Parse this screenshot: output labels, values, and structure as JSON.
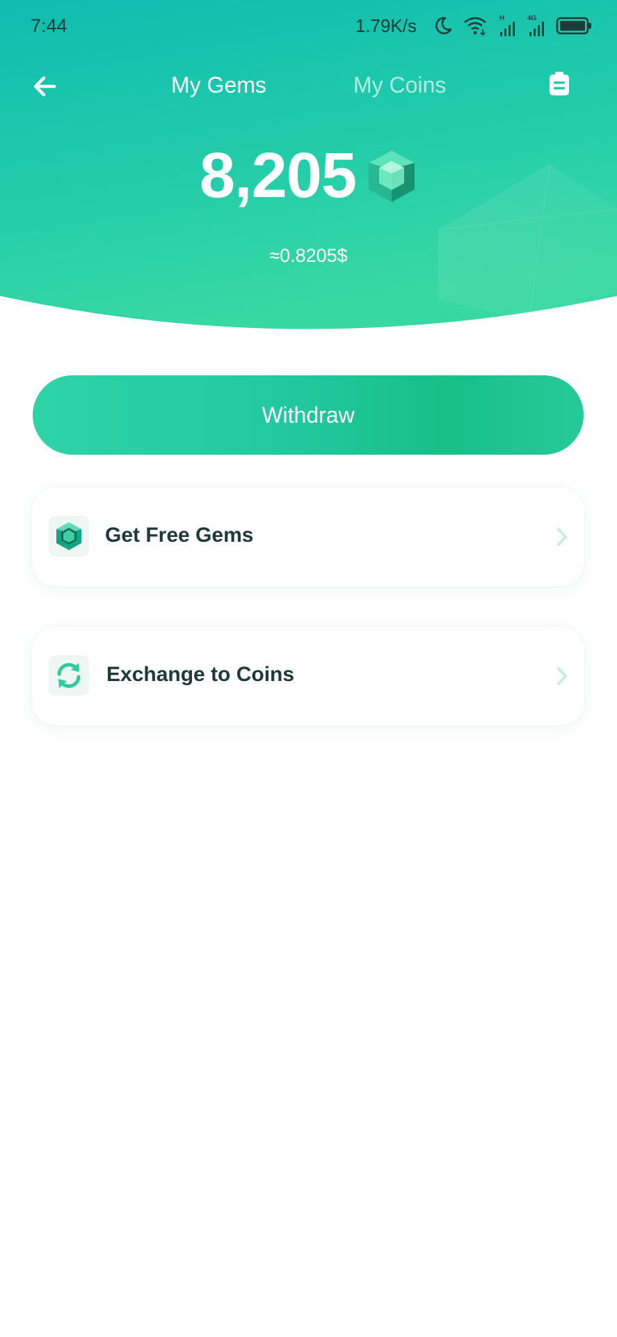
{
  "status_bar": {
    "time": "7:44",
    "network_speed": "1.79K/s",
    "icons": [
      "moon-icon",
      "wifi-icon",
      "signal-h-icon",
      "signal-4g-icon",
      "battery-icon"
    ]
  },
  "nav": {
    "back_icon": "arrow-left-icon",
    "tabs": [
      {
        "label": "My Gems",
        "active": true
      },
      {
        "label": "My Coins",
        "active": false
      }
    ],
    "record_icon": "clipboard-icon"
  },
  "balance": {
    "value": "8,205",
    "icon": "gem-icon",
    "usd_equivalent": "≈0.8205$"
  },
  "actions": {
    "withdraw_label": "Withdraw"
  },
  "menu": {
    "items": [
      {
        "label": "Get Free Gems",
        "icon": "gem-icon"
      },
      {
        "label": "Exchange to Coins",
        "icon": "refresh-icon"
      }
    ]
  },
  "colors": {
    "header_gradient_start": "#12bfae",
    "header_gradient_end": "#33d6a0",
    "accent": "#22c9a0",
    "text_dark": "#1e3a35"
  }
}
